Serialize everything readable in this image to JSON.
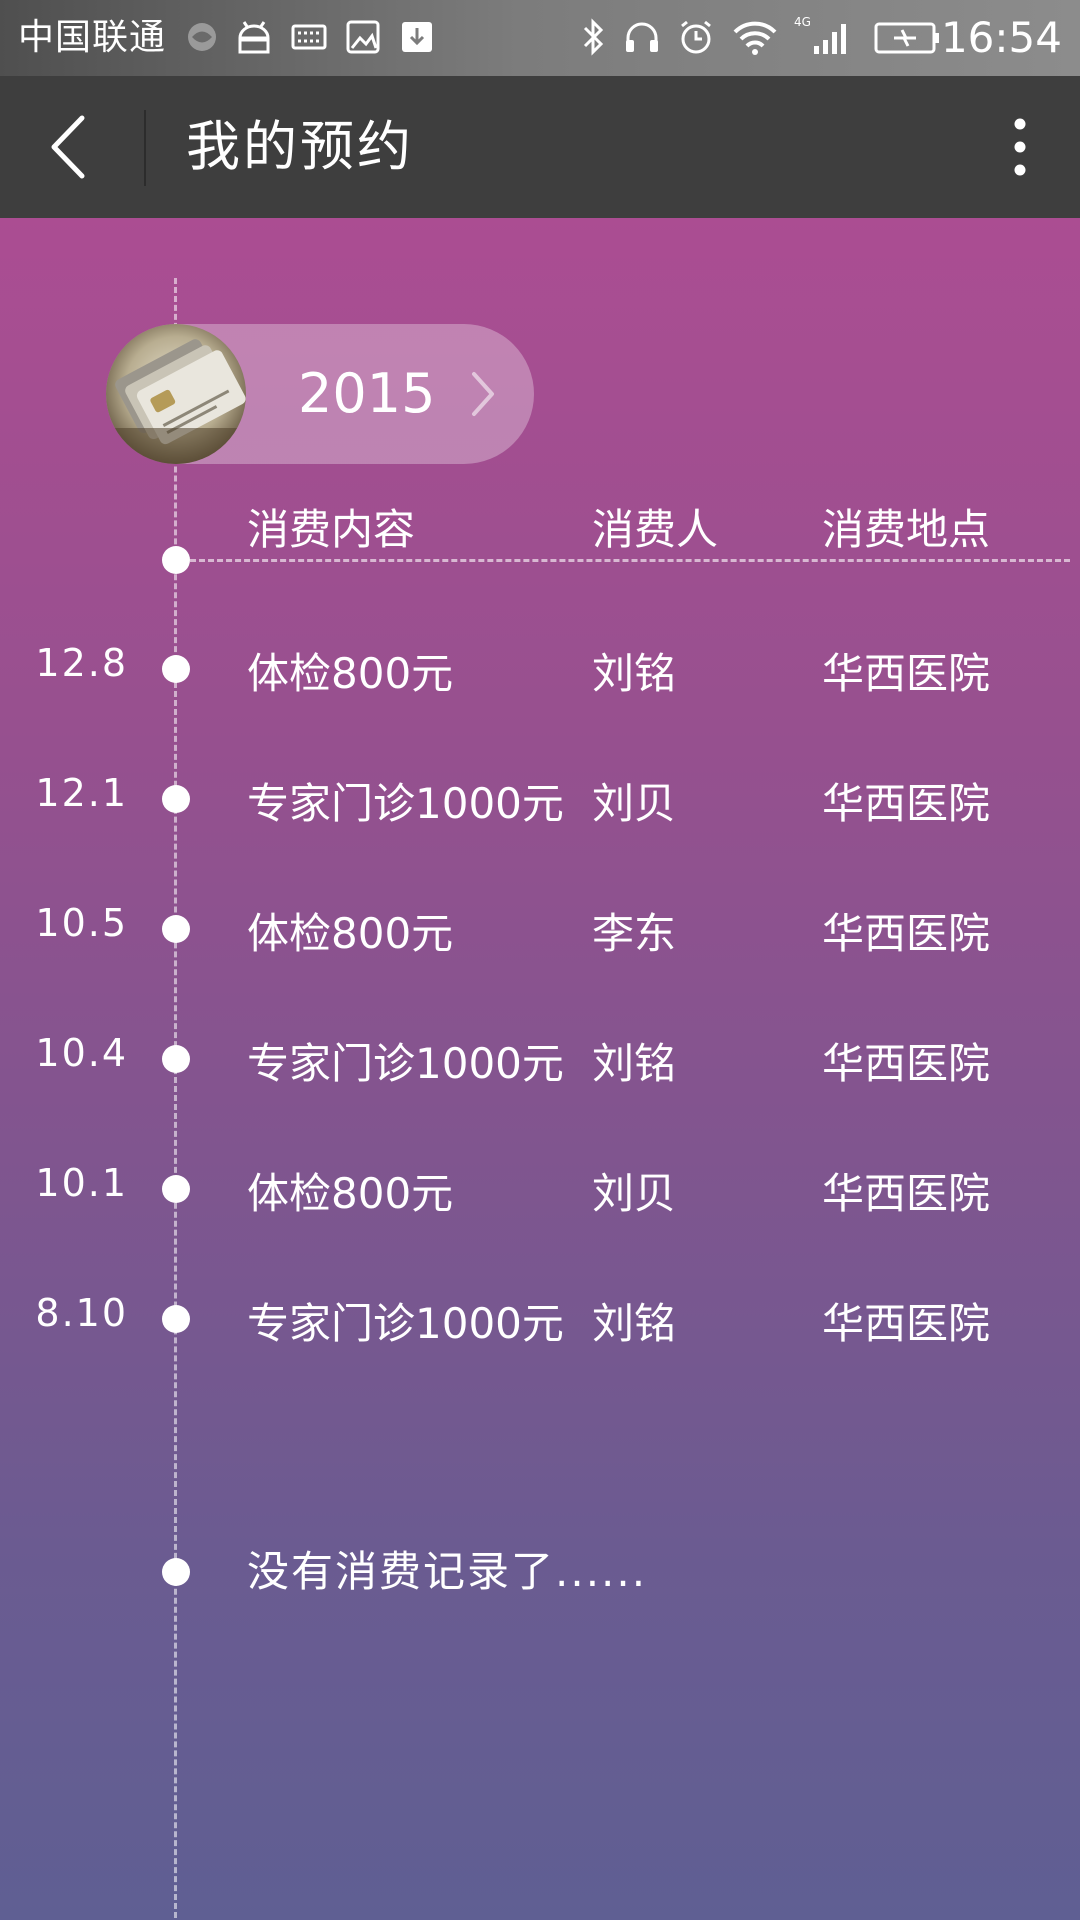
{
  "status_bar": {
    "carrier": "中国联通",
    "network": "4G",
    "time": "16:54"
  },
  "app_bar": {
    "title": "我的预约",
    "back_icon": "chevron-left-icon",
    "menu_icon": "more-vertical-icon"
  },
  "year_selector": {
    "year": "2015",
    "thumbnail_icon": "bank-cards-photo",
    "chevron_icon": "chevron-right-icon"
  },
  "table": {
    "headers": [
      "消费内容",
      "消费人",
      "消费地点"
    ],
    "rows": [
      {
        "date": "12.8",
        "content": "体检800元",
        "person": "刘铭",
        "place": "华西医院"
      },
      {
        "date": "12.1",
        "content": "专家门诊1000元",
        "person": "刘贝",
        "place": "华西医院"
      },
      {
        "date": "10.5",
        "content": "体检800元",
        "person": "李东",
        "place": "华西医院"
      },
      {
        "date": "10.4",
        "content": "专家门诊1000元",
        "person": "刘铭",
        "place": "华西医院"
      },
      {
        "date": "10.1",
        "content": "体检800元",
        "person": "刘贝",
        "place": "华西医院"
      },
      {
        "date": "8.10",
        "content": "专家门诊1000元",
        "person": "刘铭",
        "place": "华西医院"
      }
    ]
  },
  "end_message": "没有消费记录了......",
  "colors": {
    "gradient_top": "#ab4d92",
    "gradient_bottom": "#5f5f93",
    "app_bar": "#3e3e3e",
    "text": "#ffffff"
  }
}
